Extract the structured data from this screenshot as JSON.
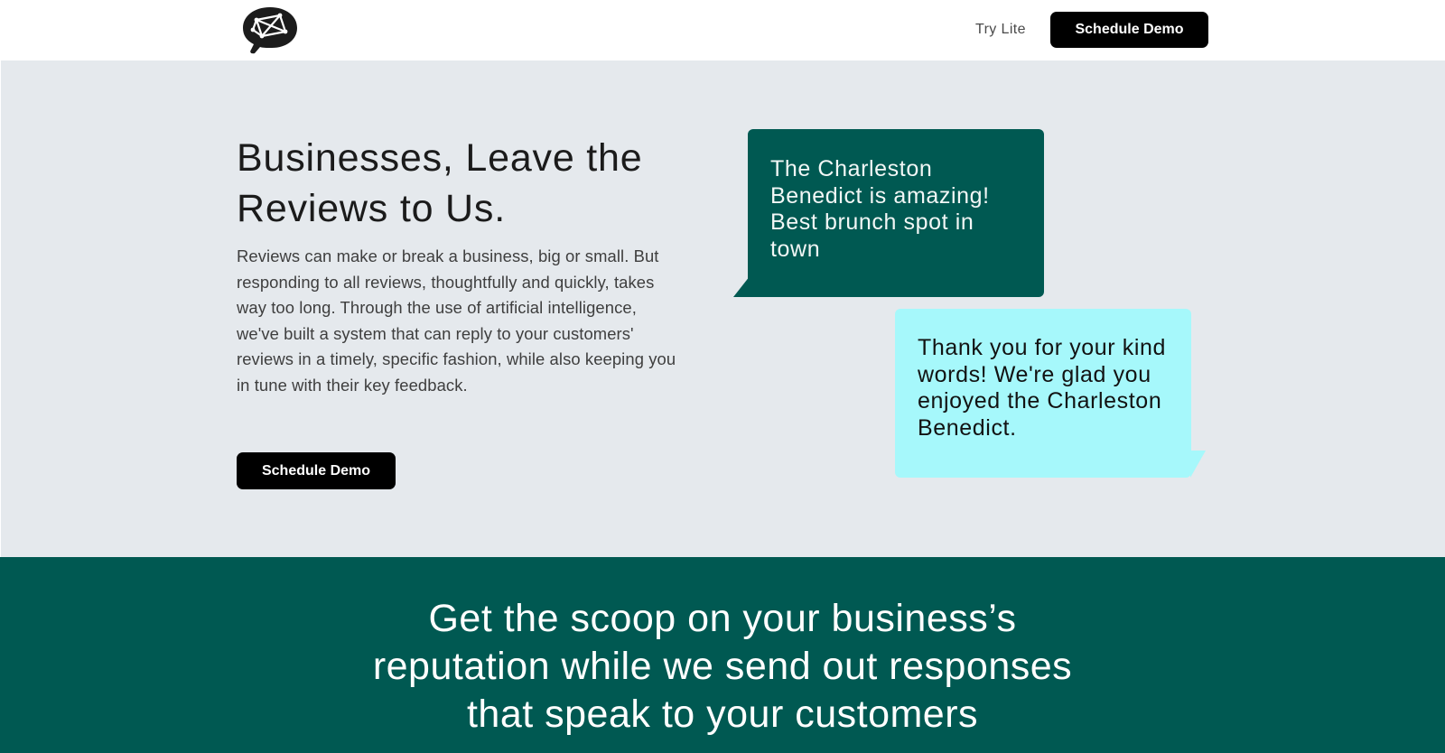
{
  "header": {
    "logo_icon": "speech-bubble-network-logo",
    "try_lite_label": "Try Lite",
    "schedule_demo_label": "Schedule Demo"
  },
  "hero": {
    "title_line1": "Businesses, Leave the",
    "title_line2": "Reviews to Us.",
    "body": "Reviews can make or break a business, big or small. But responding to all reviews, thoughtfully and quickly, takes way too long. Through the use of artificial intelligence, we've built a system that can reply to your customers' reviews in a timely, specific fashion, while also keeping you in tune with their key feedback.",
    "cta_label": "Schedule Demo"
  },
  "bubbles": {
    "review_text": "The Charleston Benedict is amazing! Best brunch spot in town",
    "reply_text": "Thank you for your kind words! We're glad you enjoyed the Charleston Benedict."
  },
  "band": {
    "line1": "Get the scoop on your business’s",
    "line2": "reputation while we send out responses",
    "line3": "that speak to your customers"
  },
  "colors": {
    "hero_background": "#e5e9ed",
    "brand_green": "#005952",
    "reply_cyan": "#a6f8fb",
    "button_black": "#000000"
  }
}
